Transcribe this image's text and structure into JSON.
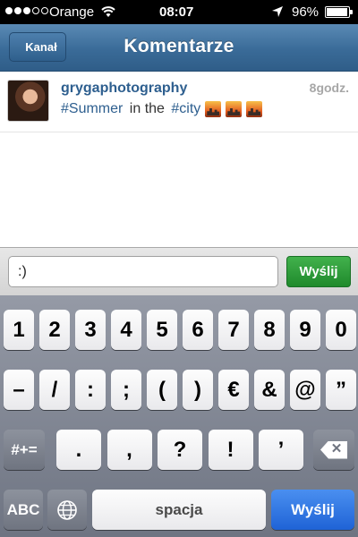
{
  "status_bar": {
    "carrier": "Orange",
    "time": "08:07",
    "battery_percent": "96%",
    "battery_level": 0.96,
    "signal_bars_filled": 3,
    "signal_bars_total": 5
  },
  "navbar": {
    "back_label": "Kanał",
    "title": "Komentarze"
  },
  "comment": {
    "username": "grygaphotography",
    "time_ago": "8godz.",
    "hashtag_1": "#Summer",
    "text_middle": " in the ",
    "hashtag_2": "#city",
    "emoji_icon": "sunset-city-icon"
  },
  "input": {
    "value": ":)",
    "send_label": "Wyślij"
  },
  "keyboard": {
    "row1": [
      "1",
      "2",
      "3",
      "4",
      "5",
      "6",
      "7",
      "8",
      "9",
      "0"
    ],
    "row2": [
      "–",
      "/",
      ":",
      ";",
      "(",
      ")",
      "€",
      "&",
      "@",
      "”"
    ],
    "row3": [
      ".",
      ",",
      "?",
      "!",
      "’"
    ],
    "shift_label": "#+=",
    "abc_label": "ABC",
    "space_label": "spacja",
    "go_label": "Wyślij"
  },
  "colors": {
    "navbar": "#3a6b98",
    "link": "#2e5f8f",
    "send_green": "#2a9b36",
    "go_blue": "#2a6fe0"
  }
}
